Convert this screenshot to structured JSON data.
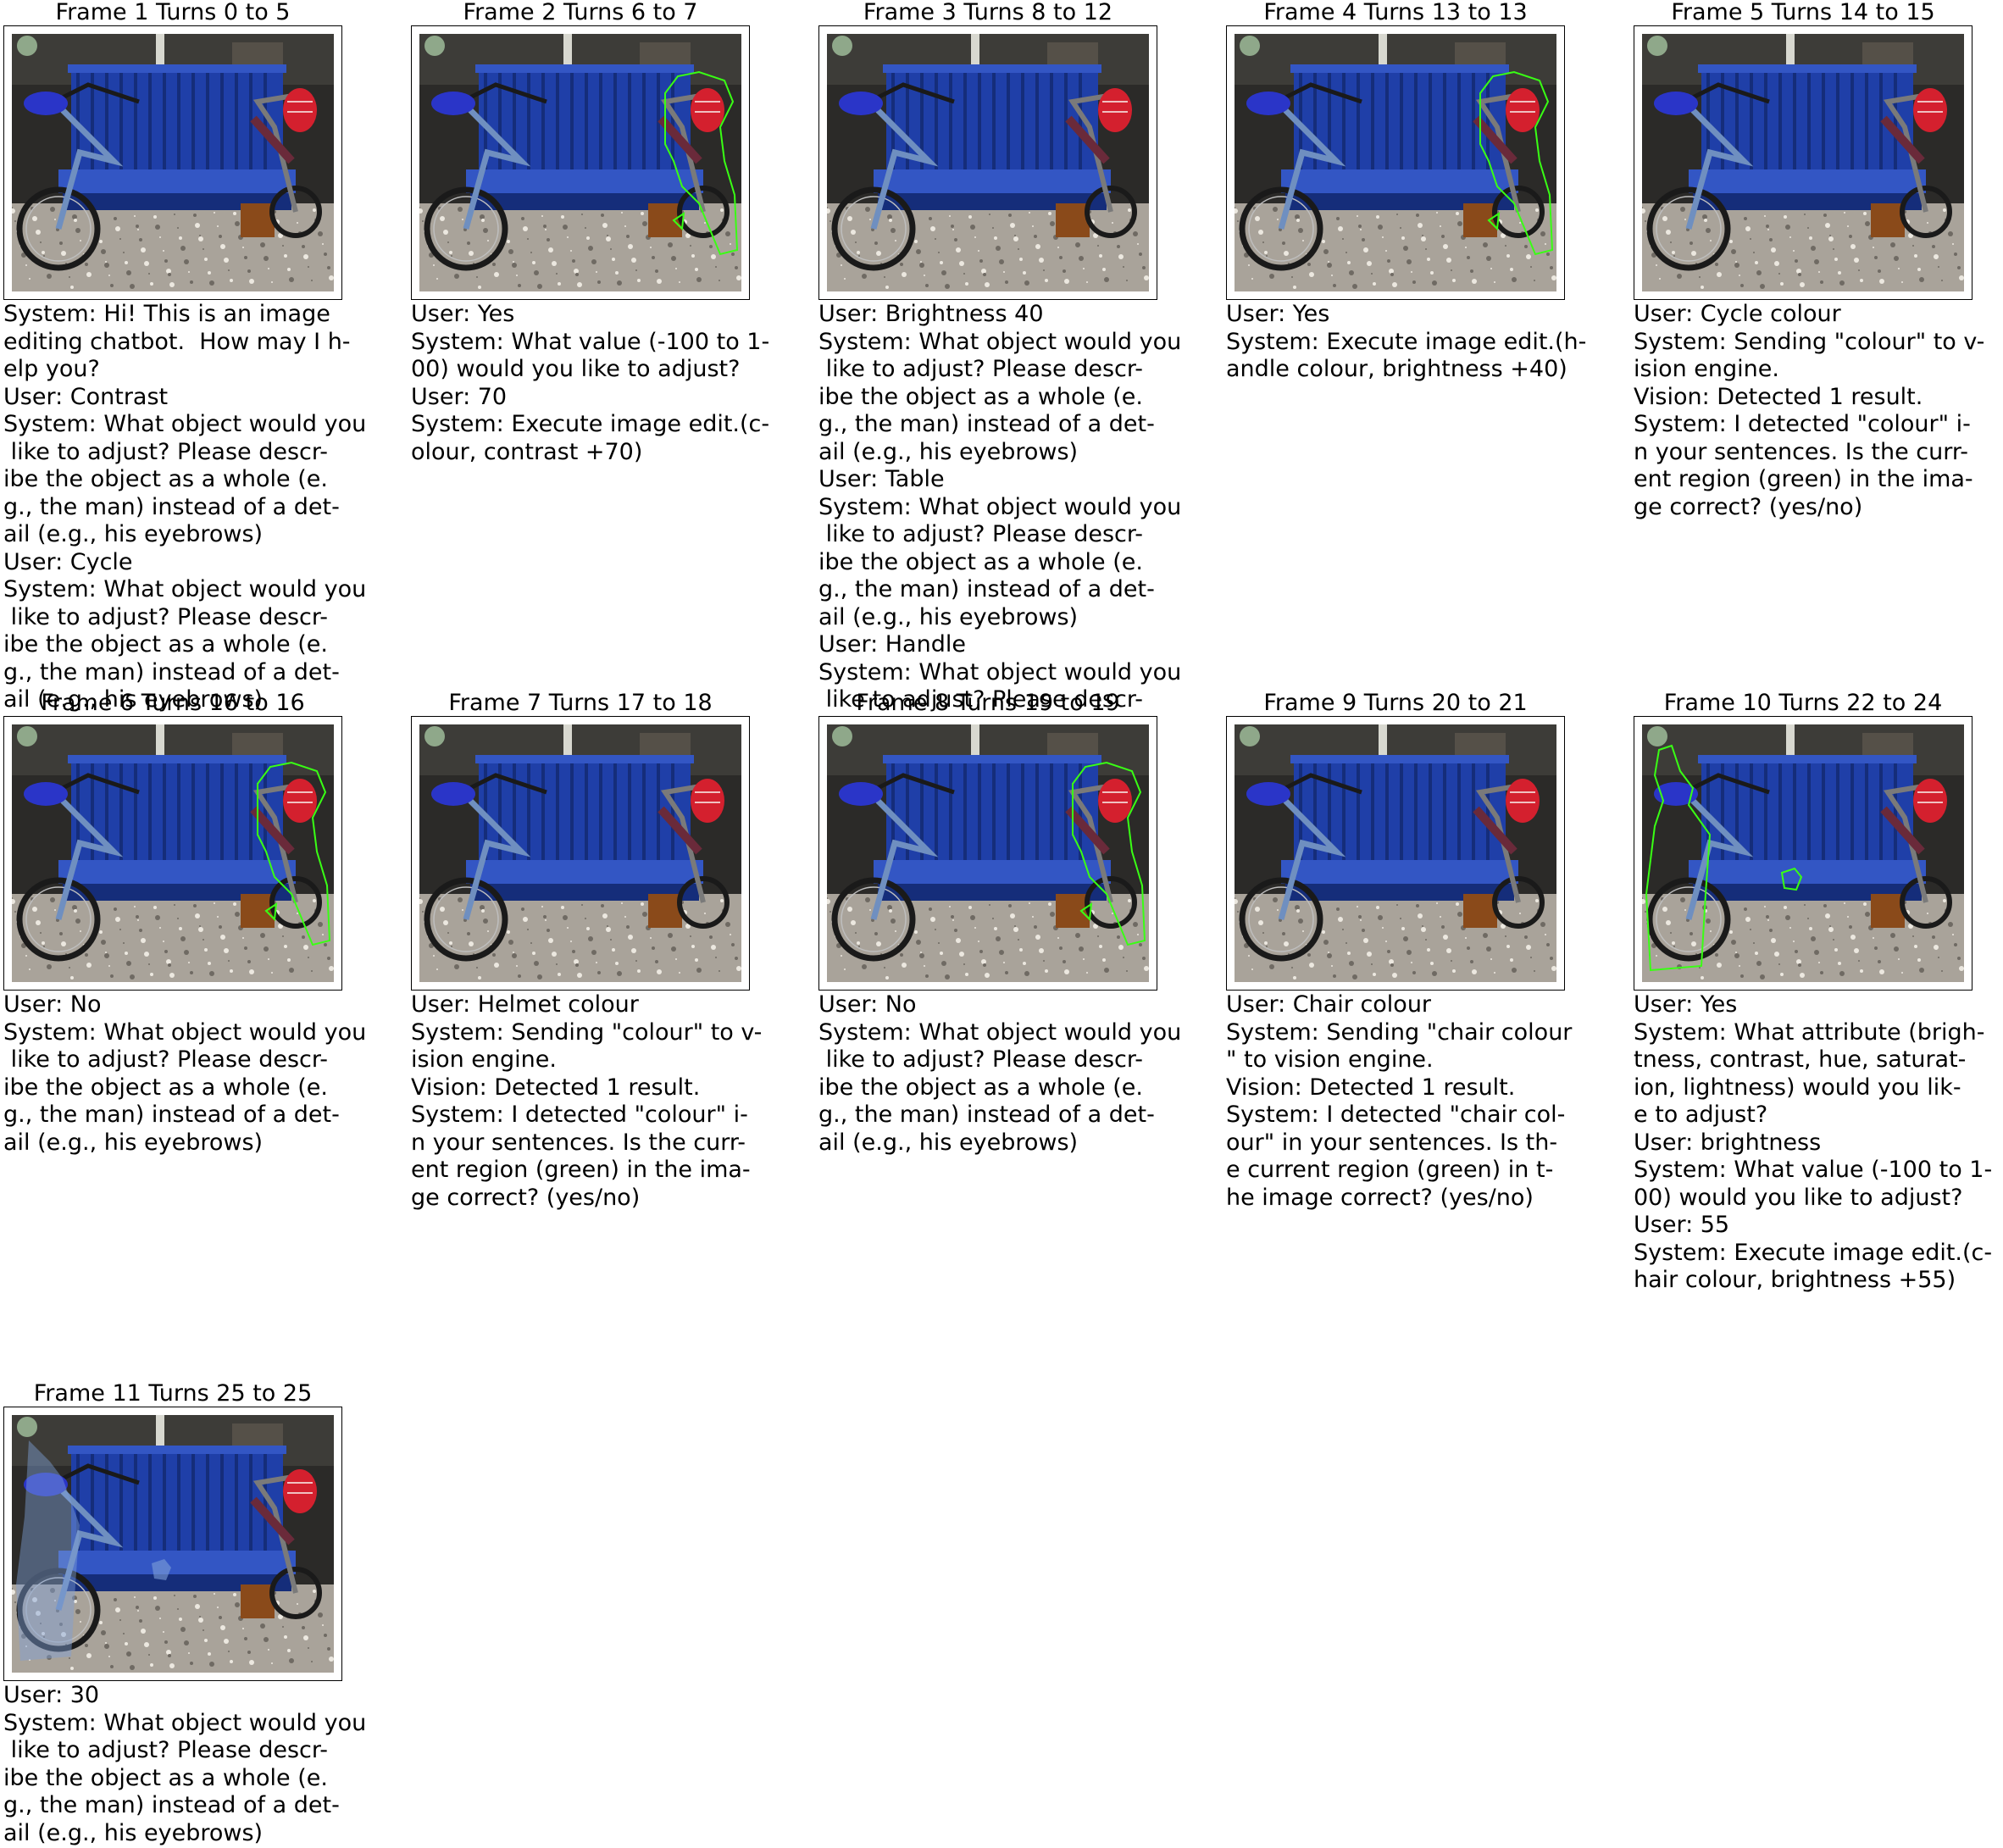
{
  "frames": [
    {
      "title": "Frame 1 Turns 0 to 5",
      "overlay": "none",
      "transcript": "System: Hi! This is an image\nediting chatbot.  How may I h-\nelp you?\nUser: Contrast\nSystem: What object would you\n like to adjust? Please descr-\nibe the object as a whole (e.\ng., the man) instead of a det-\nail (e.g., his eyebrows)\nUser: Cycle\nSystem: What object would you\n like to adjust? Please descr-\nibe the object as a whole (e.\ng., the man) instead of a det-\nail (e.g., his eyebrows)"
    },
    {
      "title": "Frame 2 Turns 6 to 7",
      "overlay": "right-bike",
      "transcript": "User: Yes\nSystem: What value (-100 to 1-\n00) would you like to adjust?\nUser: 70\nSystem: Execute image edit.(c-\nolour, contrast +70)"
    },
    {
      "title": "Frame 3 Turns 8 to 12",
      "overlay": "none",
      "transcript": "User: Brightness 40\nSystem: What object would you\n like to adjust? Please descr-\nibe the object as a whole (e.\ng., the man) instead of a det-\nail (e.g., his eyebrows)\nUser: Table\nSystem: What object would you\n like to adjust? Please descr-\nibe the object as a whole (e.\ng., the man) instead of a det-\nail (e.g., his eyebrows)\nUser: Handle\nSystem: What object would you\n like to adjust? Please descr-\nibe the object as a whole (e.\ng., the man) instead of a det-\nail (e.g., his eyebrows)\nUser: Cycle\nSystem: I detected \"colour\" i-\nn your sentences. Is the curr-\nent region (green) in the ima-\nge correct? (yes/no)"
    },
    {
      "title": "Frame 4 Turns 13 to 13",
      "overlay": "right-bike",
      "transcript": "User: Yes\nSystem: Execute image edit.(h-\nandle colour, brightness +40)"
    },
    {
      "title": "Frame 5 Turns 14 to 15",
      "overlay": "none",
      "transcript": "User: Cycle colour\nSystem: Sending \"colour\" to v-\nision engine.\nVision: Detected 1 result.\nSystem: I detected \"colour\" i-\nn your sentences. Is the curr-\nent region (green) in the ima-\nge correct? (yes/no)"
    },
    {
      "title": "Frame 6 Turns 16 to 16",
      "overlay": "right-bike",
      "transcript": "User: No\nSystem: What object would you\n like to adjust? Please descr-\nibe the object as a whole (e.\ng., the man) instead of a det-\nail (e.g., his eyebrows)"
    },
    {
      "title": "Frame 7 Turns 17 to 18",
      "overlay": "none",
      "transcript": "User: Helmet colour\nSystem: Sending \"colour\" to v-\nision engine.\nVision: Detected 1 result.\nSystem: I detected \"colour\" i-\nn your sentences. Is the curr-\nent region (green) in the ima-\nge correct? (yes/no)"
    },
    {
      "title": "Frame 8 Turns 19 to 19",
      "overlay": "right-bike",
      "transcript": "User: No\nSystem: What object would you\n like to adjust? Please descr-\nibe the object as a whole (e.\ng., the man) instead of a det-\nail (e.g., his eyebrows)"
    },
    {
      "title": "Frame 9 Turns 20 to 21",
      "overlay": "none",
      "transcript": "User: Chair colour\nSystem: Sending \"chair colour\n\" to vision engine.\nVision: Detected 1 result.\nSystem: I detected \"chair col-\nour\" in your sentences. Is th-\ne current region (green) in t-\nhe image correct? (yes/no)"
    },
    {
      "title": "Frame 10 Turns 22 to 24",
      "overlay": "left-bike",
      "transcript": "User: Yes\nSystem: What attribute (brigh-\ntness, contrast, hue, saturat-\nion, lightness) would you lik-\ne to adjust?\nUser: brightness\nSystem: What value (-100 to 1-\n00) would you like to adjust?\nUser: 55\nSystem: Execute image edit.(c-\nhair colour, brightness +55)"
    },
    {
      "title": "Frame 11 Turns 25 to 25",
      "overlay": "edited",
      "transcript": "User: 30\nSystem: What object would you\n like to adjust? Please descr-\nibe the object as a whole (e.\ng., the man) instead of a det-\nail (e.g., his eyebrows)"
    }
  ],
  "colors": {
    "bench": "#1f3fa8",
    "bench_dark": "#152d7a",
    "bench_light": "#3356c4",
    "gravel": "#a9a39a",
    "background": "#2b2a28",
    "helmet": "#d4202e",
    "overlay": "#39ff14",
    "frame_border": "#000000"
  }
}
